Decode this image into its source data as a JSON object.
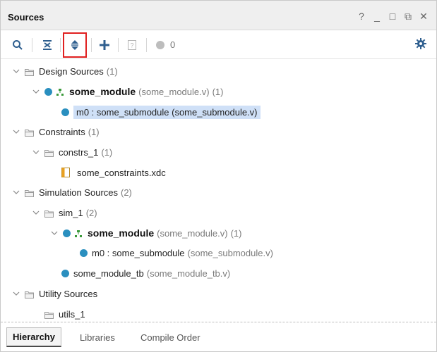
{
  "panel": {
    "title": "Sources",
    "window_controls": [
      "?",
      "_",
      "□",
      "⧉",
      "✕"
    ]
  },
  "toolbar": {
    "buttons": [
      {
        "icon": "search-icon"
      },
      {
        "icon": "collapse-all-icon"
      },
      {
        "icon": "expand-all-icon"
      },
      {
        "icon": "add-icon"
      },
      {
        "icon": "unknown-file-icon"
      },
      {
        "icon": "status-circle-icon"
      }
    ],
    "count": "0",
    "settings_icon": "gear-icon"
  },
  "tree": {
    "design_sources": {
      "label": "Design Sources",
      "count": "(1)"
    },
    "some_module": {
      "name": "some_module",
      "file": "(some_module.v)",
      "count": "(1)"
    },
    "m0_design": {
      "label": "m0 : some_submodule (some_submodule.v)"
    },
    "constraints": {
      "label": "Constraints",
      "count": "(1)"
    },
    "constrs_1": {
      "label": "constrs_1",
      "count": "(1)"
    },
    "xdc_file": {
      "label": "some_constraints.xdc"
    },
    "simulation_sources": {
      "label": "Simulation Sources",
      "count": "(2)"
    },
    "sim_1": {
      "label": "sim_1",
      "count": "(2)"
    },
    "sim_some_module": {
      "name": "some_module",
      "file": "(some_module.v)",
      "count": "(1)"
    },
    "sim_m0": {
      "label": "m0 : some_submodule",
      "file": "(some_submodule.v)"
    },
    "tb": {
      "label": "some_module_tb",
      "file": "(some_module_tb.v)"
    },
    "utility_sources": {
      "label": "Utility Sources"
    },
    "utils_1": {
      "label": "utils_1"
    }
  },
  "tabs": [
    "Hierarchy",
    "Libraries",
    "Compile Order"
  ],
  "colors": {
    "accent_blue": "#2a8fbf",
    "selection": "#cfe0f7",
    "highlight_red": "#e02020",
    "hier_green": "#3b9a3b"
  }
}
